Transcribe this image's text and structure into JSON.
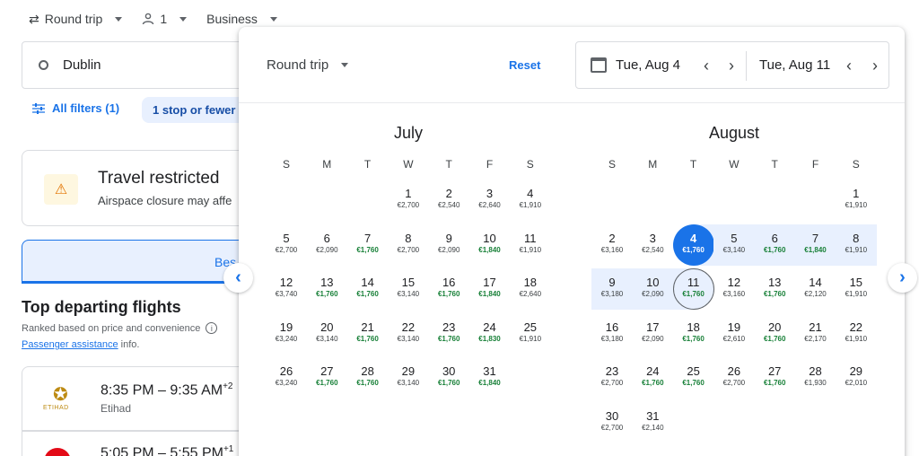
{
  "search": {
    "trip_type": "Round trip",
    "passengers": "1",
    "cabin": "Business",
    "origin": "Dublin",
    "all_filters": "All filters (1)",
    "stops_chip": "1 stop or fewer"
  },
  "warning": {
    "title": "Travel restricted",
    "subtitle": "Airspace closure may affe"
  },
  "tabs": {
    "best": "Bes"
  },
  "results": {
    "title": "Top departing flights",
    "ranked_note": "Ranked based on price and convenience",
    "passenger_link": "Passenger assistance",
    "passenger_suffix": " info.",
    "flights": [
      {
        "time": "8:35 PM – 9:35 AM",
        "day_offset": "+2",
        "carrier": "Etihad",
        "logo_text": "ETIHAD"
      },
      {
        "time": "5:05 PM – 5:55 PM",
        "day_offset": "+1",
        "carrier": ""
      }
    ]
  },
  "picker": {
    "trip_type": "Round trip",
    "reset": "Reset",
    "departure": "Tue, Aug 4",
    "return": "Tue, Aug 11",
    "weekdays": [
      "S",
      "M",
      "T",
      "W",
      "T",
      "F",
      "S"
    ],
    "months": [
      {
        "name": "July",
        "first_weekday": 3,
        "days": [
          {
            "d": "1",
            "p": "€2,700"
          },
          {
            "d": "2",
            "p": "€2,540"
          },
          {
            "d": "3",
            "p": "€2,640"
          },
          {
            "d": "4",
            "p": "€1,910"
          },
          {
            "d": "5",
            "p": "€2,700"
          },
          {
            "d": "6",
            "p": "€2,090"
          },
          {
            "d": "7",
            "p": "€1,760",
            "low": true
          },
          {
            "d": "8",
            "p": "€2,700"
          },
          {
            "d": "9",
            "p": "€2,090"
          },
          {
            "d": "10",
            "p": "€1,840",
            "low": true
          },
          {
            "d": "11",
            "p": "€1,910"
          },
          {
            "d": "12",
            "p": "€3,740"
          },
          {
            "d": "13",
            "p": "€1,760",
            "low": true
          },
          {
            "d": "14",
            "p": "€1,760",
            "low": true
          },
          {
            "d": "15",
            "p": "€3,140"
          },
          {
            "d": "16",
            "p": "€1,760",
            "low": true
          },
          {
            "d": "17",
            "p": "€1,840",
            "low": true
          },
          {
            "d": "18",
            "p": "€2,640"
          },
          {
            "d": "19",
            "p": "€3,240"
          },
          {
            "d": "20",
            "p": "€3,140"
          },
          {
            "d": "21",
            "p": "€1,760",
            "low": true
          },
          {
            "d": "22",
            "p": "€3,140"
          },
          {
            "d": "23",
            "p": "€1,760",
            "low": true
          },
          {
            "d": "24",
            "p": "€1,830",
            "low": true
          },
          {
            "d": "25",
            "p": "€1,910"
          },
          {
            "d": "26",
            "p": "€3,240"
          },
          {
            "d": "27",
            "p": "€1,760",
            "low": true
          },
          {
            "d": "28",
            "p": "€1,760",
            "low": true
          },
          {
            "d": "29",
            "p": "€3,140"
          },
          {
            "d": "30",
            "p": "€1,760",
            "low": true
          },
          {
            "d": "31",
            "p": "€1,840",
            "low": true
          }
        ]
      },
      {
        "name": "August",
        "first_weekday": 6,
        "days": [
          {
            "d": "1",
            "p": "€1,910"
          },
          {
            "d": "2",
            "p": "€3,160"
          },
          {
            "d": "3",
            "p": "€2,540"
          },
          {
            "d": "4",
            "p": "€1,760",
            "low": true,
            "state": "selected"
          },
          {
            "d": "5",
            "p": "€3,140",
            "state": "range"
          },
          {
            "d": "6",
            "p": "€1,760",
            "low": true,
            "state": "range"
          },
          {
            "d": "7",
            "p": "€1,840",
            "low": true,
            "state": "range"
          },
          {
            "d": "8",
            "p": "€1,910",
            "state": "range"
          },
          {
            "d": "9",
            "p": "€3,180",
            "state": "range"
          },
          {
            "d": "10",
            "p": "€2,090",
            "state": "range"
          },
          {
            "d": "11",
            "p": "€1,760",
            "low": true,
            "state": "return"
          },
          {
            "d": "12",
            "p": "€3,160"
          },
          {
            "d": "13",
            "p": "€1,760",
            "low": true
          },
          {
            "d": "14",
            "p": "€2,120"
          },
          {
            "d": "15",
            "p": "€1,910"
          },
          {
            "d": "16",
            "p": "€3,180"
          },
          {
            "d": "17",
            "p": "€2,090"
          },
          {
            "d": "18",
            "p": "€1,760",
            "low": true
          },
          {
            "d": "19",
            "p": "€2,610"
          },
          {
            "d": "20",
            "p": "€1,760",
            "low": true
          },
          {
            "d": "21",
            "p": "€2,170"
          },
          {
            "d": "22",
            "p": "€1,910"
          },
          {
            "d": "23",
            "p": "€2,700"
          },
          {
            "d": "24",
            "p": "€1,760",
            "low": true
          },
          {
            "d": "25",
            "p": "€1,760",
            "low": true
          },
          {
            "d": "26",
            "p": "€2,700"
          },
          {
            "d": "27",
            "p": "€1,760",
            "low": true
          },
          {
            "d": "28",
            "p": "€1,930"
          },
          {
            "d": "29",
            "p": "€2,010"
          },
          {
            "d": "30",
            "p": "€2,700"
          },
          {
            "d": "31",
            "p": "€2,140"
          }
        ]
      }
    ]
  },
  "colors": {
    "accent": "#1a73e8",
    "low_price": "#188038",
    "range": "#e8f0fe",
    "warning": "#e37400"
  },
  "icons": [
    "swap-icon",
    "person-icon",
    "ring-icon",
    "tune-icon",
    "warning-icon",
    "info-icon",
    "calendar-icon",
    "chevron-left-icon",
    "chevron-right-icon",
    "etihad-logo",
    "turkish-logo"
  ]
}
